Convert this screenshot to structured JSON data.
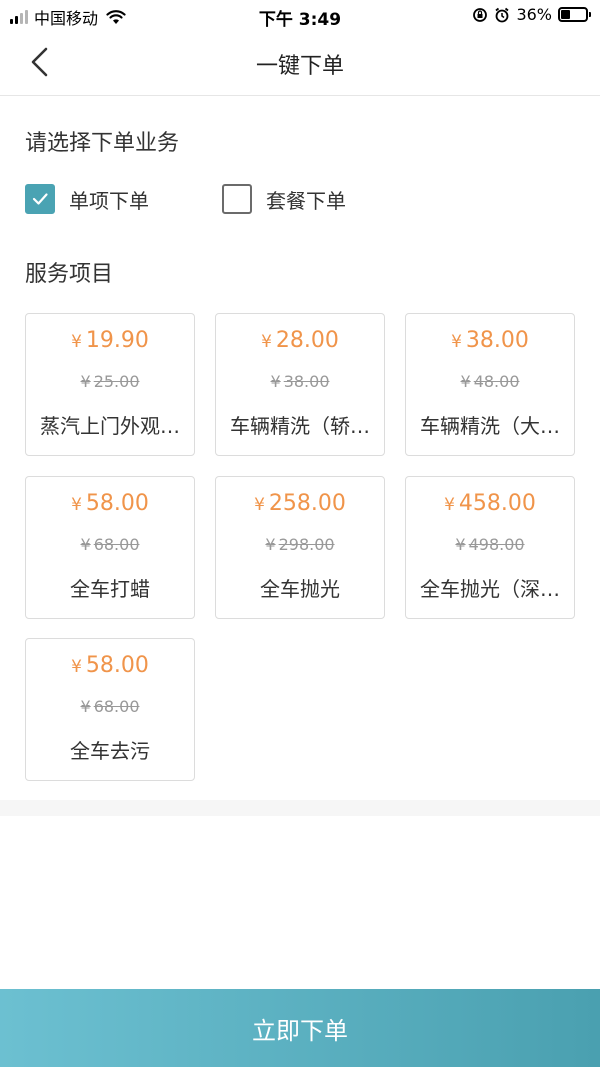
{
  "status_bar": {
    "carrier": "中国移动",
    "time": "下午 3:49",
    "battery": "36%",
    "battery_level": 0.36
  },
  "nav": {
    "title": "一键下单"
  },
  "order_type": {
    "heading": "请选择下单业务",
    "options": [
      {
        "label": "单项下单",
        "checked": true
      },
      {
        "label": "套餐下单",
        "checked": false
      }
    ]
  },
  "services": {
    "heading": "服务项目",
    "currency": "¥",
    "items": [
      {
        "price": "19.90",
        "original": "25.00",
        "name": "蒸汽上门外观…"
      },
      {
        "price": "28.00",
        "original": "38.00",
        "name": "车辆精洗（轿…"
      },
      {
        "price": "38.00",
        "original": "48.00",
        "name": "车辆精洗（大…"
      },
      {
        "price": "58.00",
        "original": "68.00",
        "name": "全车打蜡"
      },
      {
        "price": "258.00",
        "original": "298.00",
        "name": "全车抛光"
      },
      {
        "price": "458.00",
        "original": "498.00",
        "name": "全车抛光（深…"
      },
      {
        "price": "58.00",
        "original": "68.00",
        "name": "全车去污"
      }
    ]
  },
  "submit": {
    "label": "立即下单"
  },
  "colors": {
    "accent": "#4aa3b3",
    "price": "#f0944a",
    "button_gradient_start": "#6cc0d1",
    "button_gradient_end": "#4aa0b0"
  }
}
